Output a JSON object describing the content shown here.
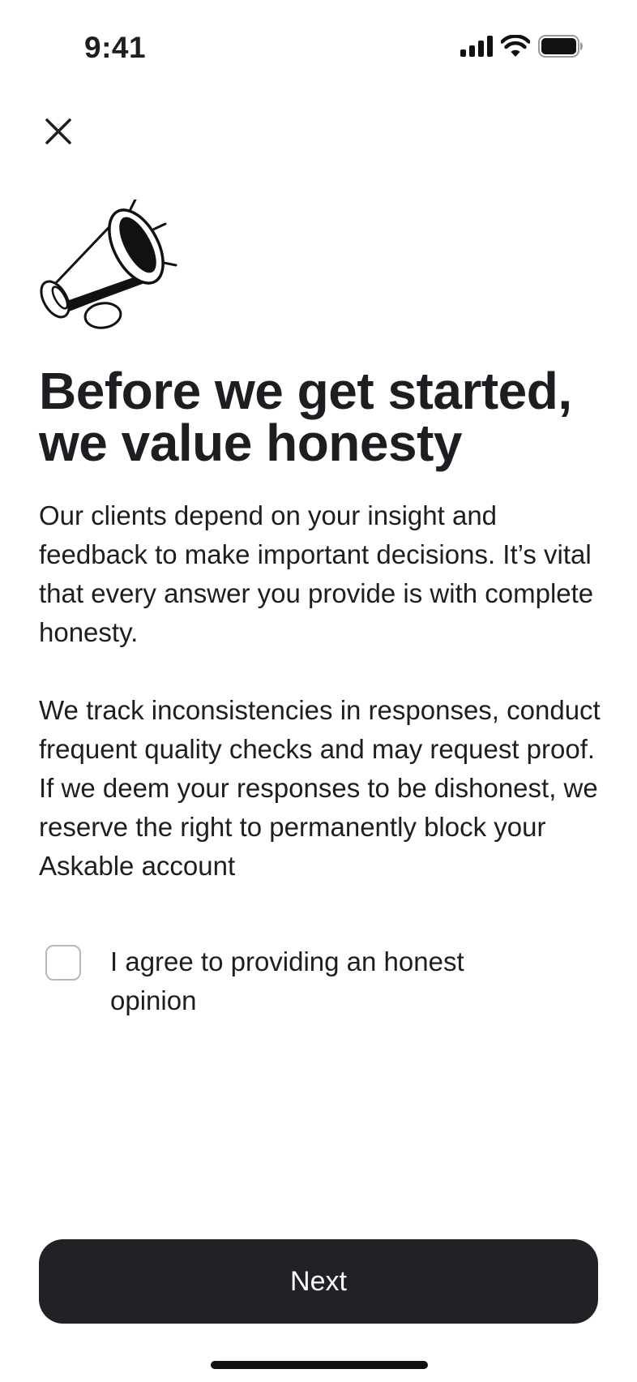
{
  "status_bar": {
    "time": "9:41",
    "icons": [
      "cellular-signal-icon",
      "wifi-icon",
      "battery-icon"
    ]
  },
  "header": {
    "close_icon": "close-icon"
  },
  "illustration": {
    "icon": "megaphone-icon"
  },
  "main": {
    "title": "Before we get started, we value honesty",
    "paragraph_1": "Our clients depend on your insight and feedback to make important decisions. It’s vital that every answer you provide is with complete honesty.",
    "paragraph_2": "We track inconsistencies in responses, conduct frequent quality checks and may request proof. If we deem your responses to be dishonest, we reserve the right to permanently block your Askable account"
  },
  "agreement": {
    "label": "I agree to providing an honest opinion",
    "checked": false
  },
  "footer": {
    "next_label": "Next"
  },
  "colors": {
    "text": "#1e1e22",
    "button_bg": "#222226",
    "button_text": "#ffffff",
    "checkbox_border": "#b7b7bc",
    "background": "#ffffff"
  }
}
